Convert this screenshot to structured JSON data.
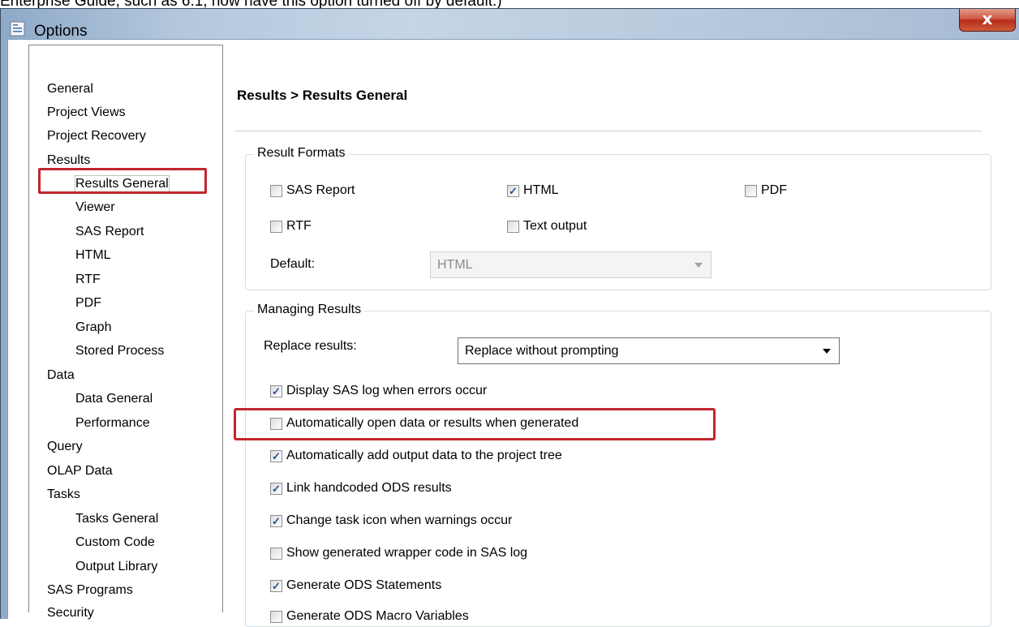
{
  "caption": "Enterprise Guide, such as 6.1, now have this option turned off by default.)",
  "window": {
    "title": "Options",
    "close_label": "x"
  },
  "nav": {
    "items": [
      {
        "label": "General",
        "level": 0
      },
      {
        "label": "Project Views",
        "level": 0
      },
      {
        "label": "Project Recovery",
        "level": 0
      },
      {
        "label": "Results",
        "level": 0
      },
      {
        "label": "Results General",
        "level": 1,
        "selected": true
      },
      {
        "label": "Viewer",
        "level": 1
      },
      {
        "label": "SAS Report",
        "level": 1
      },
      {
        "label": "HTML",
        "level": 1
      },
      {
        "label": "RTF",
        "level": 1
      },
      {
        "label": "PDF",
        "level": 1
      },
      {
        "label": "Graph",
        "level": 1
      },
      {
        "label": "Stored Process",
        "level": 1
      },
      {
        "label": "Data",
        "level": 0
      },
      {
        "label": "Data General",
        "level": 1
      },
      {
        "label": "Performance",
        "level": 1
      },
      {
        "label": "Query",
        "level": 0
      },
      {
        "label": "OLAP Data",
        "level": 0
      },
      {
        "label": "Tasks",
        "level": 0
      },
      {
        "label": "Tasks General",
        "level": 1
      },
      {
        "label": "Custom Code",
        "level": 1
      },
      {
        "label": "Output Library",
        "level": 1
      },
      {
        "label": "SAS Programs",
        "level": 0
      },
      {
        "label": "Security",
        "level": 0
      }
    ]
  },
  "page_title": "Results > Results General",
  "result_formats": {
    "legend": "Result Formats",
    "options": {
      "sas_report": {
        "label": "SAS Report",
        "checked": false
      },
      "html": {
        "label": "HTML",
        "checked": true
      },
      "pdf": {
        "label": "PDF",
        "checked": false
      },
      "rtf": {
        "label": "RTF",
        "checked": false
      },
      "text_output": {
        "label": "Text output",
        "checked": false
      }
    },
    "default_label": "Default:",
    "default_value": "HTML"
  },
  "managing_results": {
    "legend": "Managing Results",
    "replace_label": "Replace results:",
    "replace_value": "Replace without prompting",
    "options": [
      {
        "label": "Display SAS log when errors occur",
        "checked": true
      },
      {
        "label": "Automatically open data or results when generated",
        "checked": false
      },
      {
        "label": "Automatically add output data to the project tree",
        "checked": true
      },
      {
        "label": "Link handcoded ODS results",
        "checked": true
      },
      {
        "label": "Change task icon when warnings occur",
        "checked": true
      },
      {
        "label": "Show generated wrapper code in SAS log",
        "checked": false
      },
      {
        "label": "Generate ODS Statements",
        "checked": true
      },
      {
        "label": "Generate ODS Macro Variables",
        "checked": false
      }
    ]
  },
  "highlight_color": "#c0272d",
  "check_glyph": "✓"
}
